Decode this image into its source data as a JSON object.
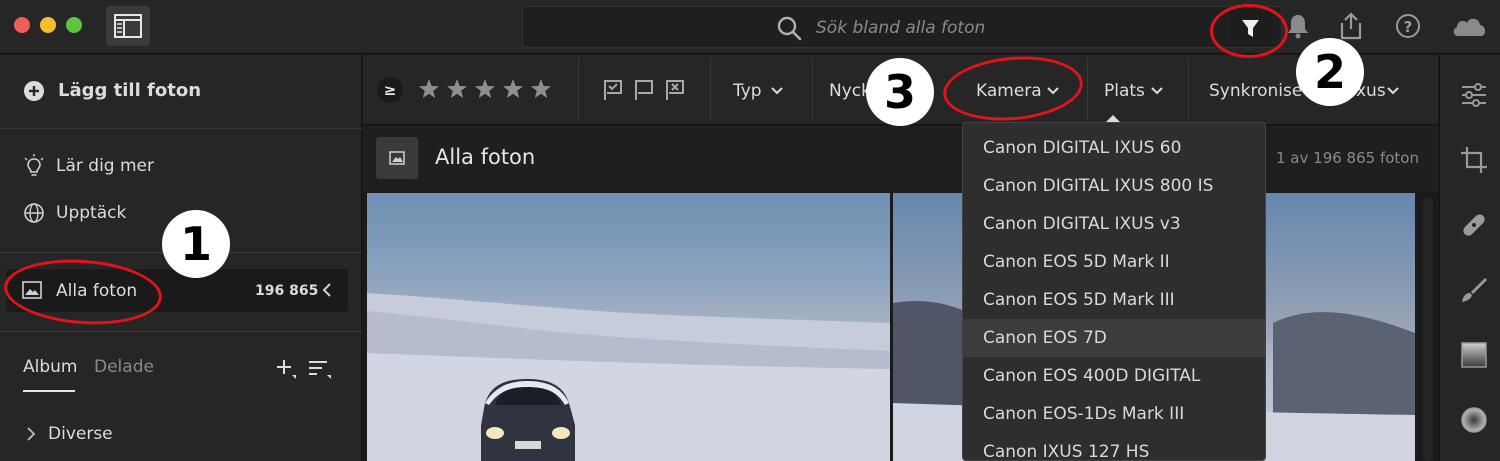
{
  "window": {
    "search_placeholder": "Sök bland alla foton"
  },
  "left_panel": {
    "add_photos": "Lägg till foton",
    "learn_more": "Lär dig mer",
    "discover": "Upptäck",
    "all_photos_label": "Alla foton",
    "all_photos_count": "196 865",
    "tabs": [
      "Album",
      "Delade"
    ],
    "album_item": "Diverse"
  },
  "filter_bar": {
    "rating_operator": "≥",
    "stars": 5,
    "type_label": "Typ",
    "keyword_label": "Nyck",
    "camera_label": "Kamera",
    "place_label": "Plats",
    "sync_label": "Synkronise",
    "sync_label_tail": "xus"
  },
  "content": {
    "title": "Alla foton",
    "count_text": "1 av 196 865 foton"
  },
  "camera_dropdown": {
    "selected": "Canon EOS 7D",
    "items": [
      "Canon DIGITAL IXUS 60",
      "Canon DIGITAL IXUS 800 IS",
      "Canon DIGITAL IXUS v3",
      "Canon EOS 5D Mark II",
      "Canon EOS 5D Mark III",
      "Canon EOS 7D",
      "Canon EOS 400D DIGITAL",
      "Canon EOS-1Ds Mark III",
      "Canon IXUS 127 HS"
    ]
  },
  "annotations": [
    "1",
    "2",
    "3"
  ],
  "colors": {
    "accent_red": "#e0141a",
    "traffic_red": "#ee5f57",
    "traffic_yellow": "#f5bd30",
    "traffic_green": "#5ec33f"
  }
}
